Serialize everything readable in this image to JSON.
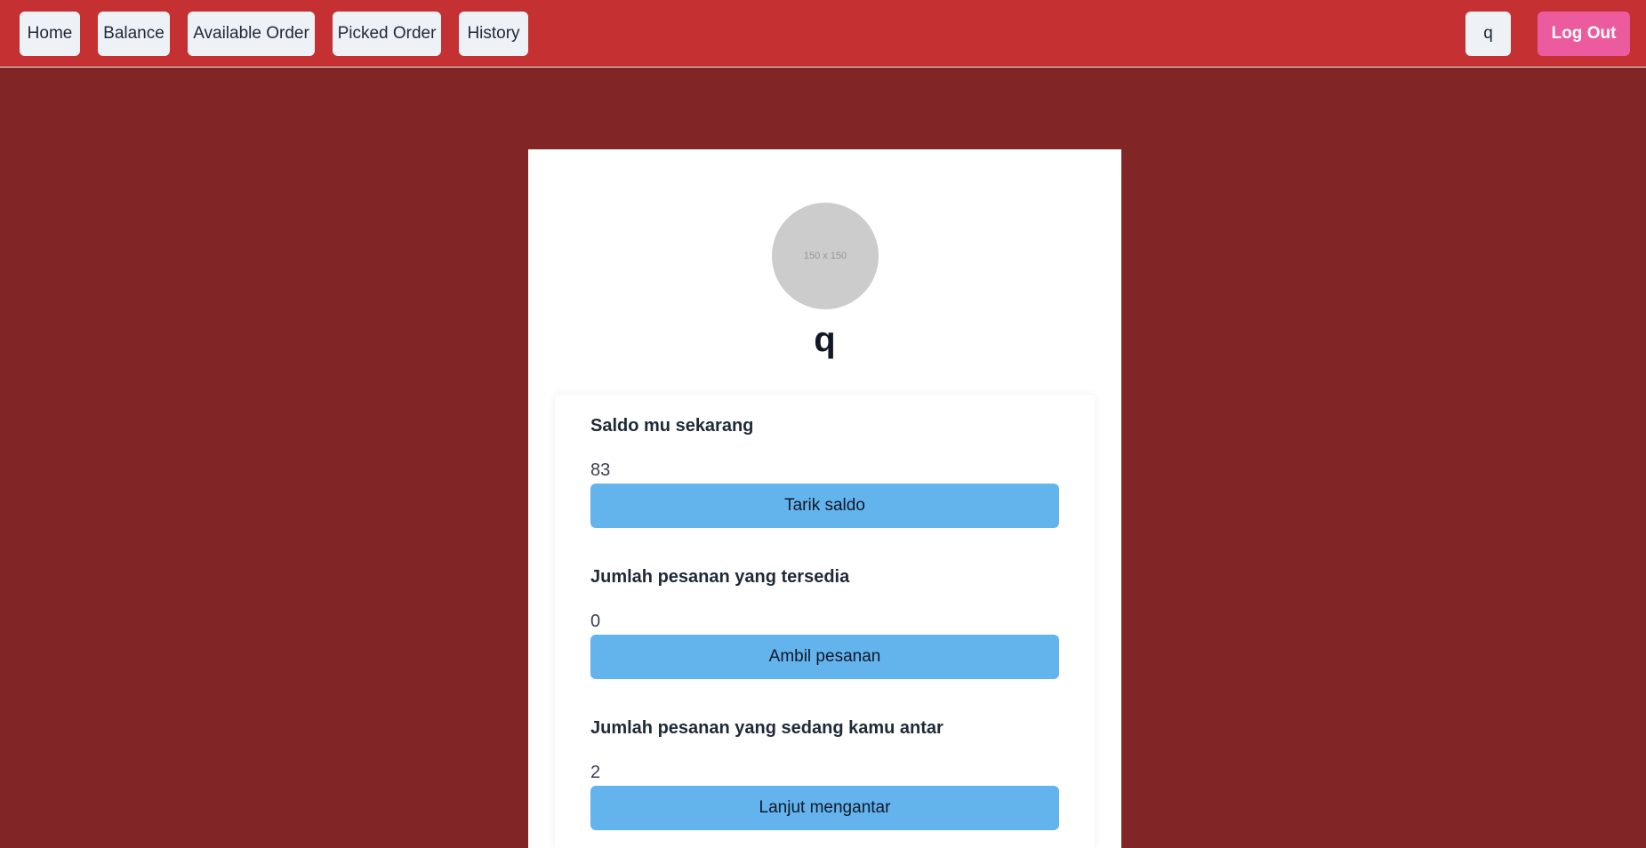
{
  "navbar": {
    "items": [
      {
        "label": "Home"
      },
      {
        "label": "Balance"
      },
      {
        "label": "Available Order"
      },
      {
        "label": "Picked Order"
      },
      {
        "label": "History"
      }
    ],
    "user_label": "q",
    "logout_label": "Log Out"
  },
  "profile": {
    "avatar_text": "150 x 150",
    "username": "q"
  },
  "sections": [
    {
      "title": "Saldo mu sekarang",
      "value": "83",
      "button": "Tarik saldo"
    },
    {
      "title": "Jumlah pesanan yang tersedia",
      "value": "0",
      "button": "Ambil pesanan"
    },
    {
      "title": "Jumlah pesanan yang sedang kamu antar",
      "value": "2",
      "button": "Lanjut mengantar"
    }
  ],
  "colors": {
    "navbar": "#c53033",
    "background": "#822527",
    "action_button": "#63b3ed",
    "logout_button": "#ec5b9e"
  }
}
